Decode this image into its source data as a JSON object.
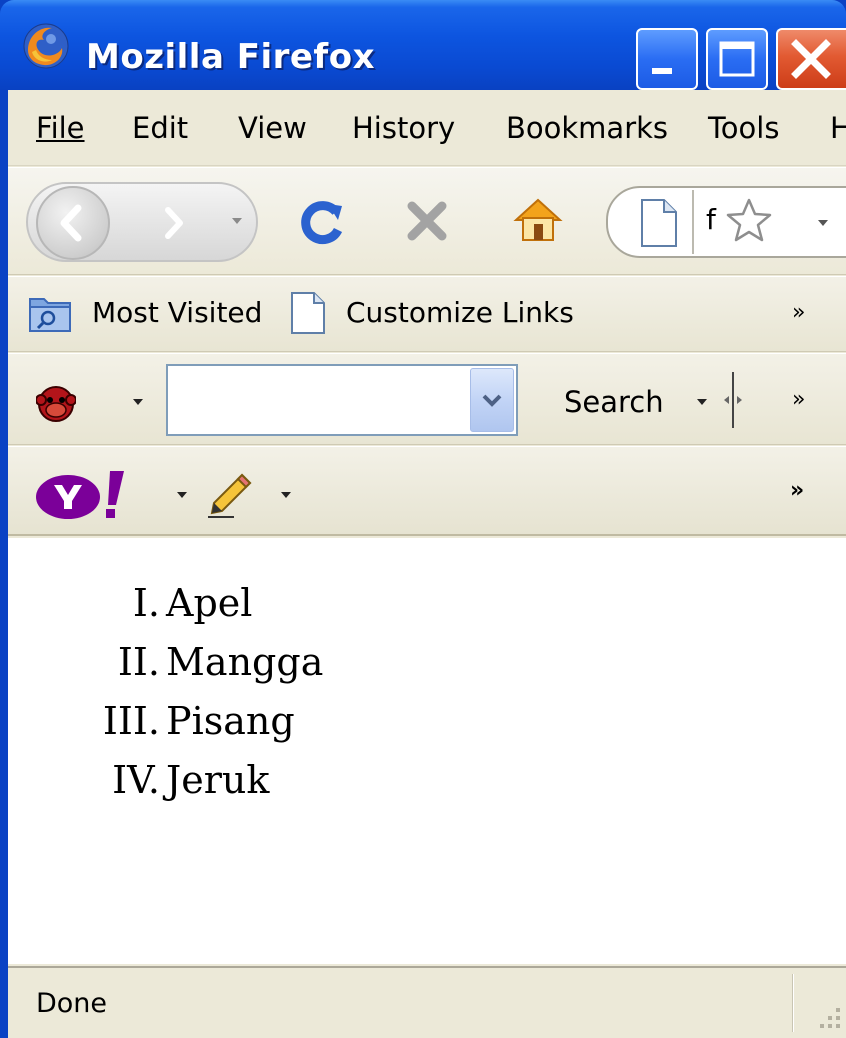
{
  "window": {
    "title": "Mozilla Firefox"
  },
  "menu": {
    "file": "File",
    "edit": "Edit",
    "view": "View",
    "history": "History",
    "bookmarks": "Bookmarks",
    "tools": "Tools",
    "help_partial": "H"
  },
  "navigation": {
    "url_text": "f"
  },
  "bookmarks_toolbar": {
    "most_visited": "Most Visited",
    "customize_links": "Customize Links",
    "overflow": "»"
  },
  "search_toolbar": {
    "search_value": "",
    "search_label": "Search",
    "overflow": "»"
  },
  "yahoo_toolbar": {
    "overflow": "»"
  },
  "page": {
    "list_items": [
      {
        "number": "I.",
        "text": "Apel"
      },
      {
        "number": "II.",
        "text": "Mangga"
      },
      {
        "number": "III.",
        "text": "Pisang"
      },
      {
        "number": "IV.",
        "text": "Jeruk"
      }
    ]
  },
  "status": {
    "text": "Done"
  },
  "colors": {
    "titlebar": "#0d55e0",
    "chrome": "#ece9d8",
    "close_button": "#e25a32",
    "yahoo_purple": "#7b0099"
  }
}
